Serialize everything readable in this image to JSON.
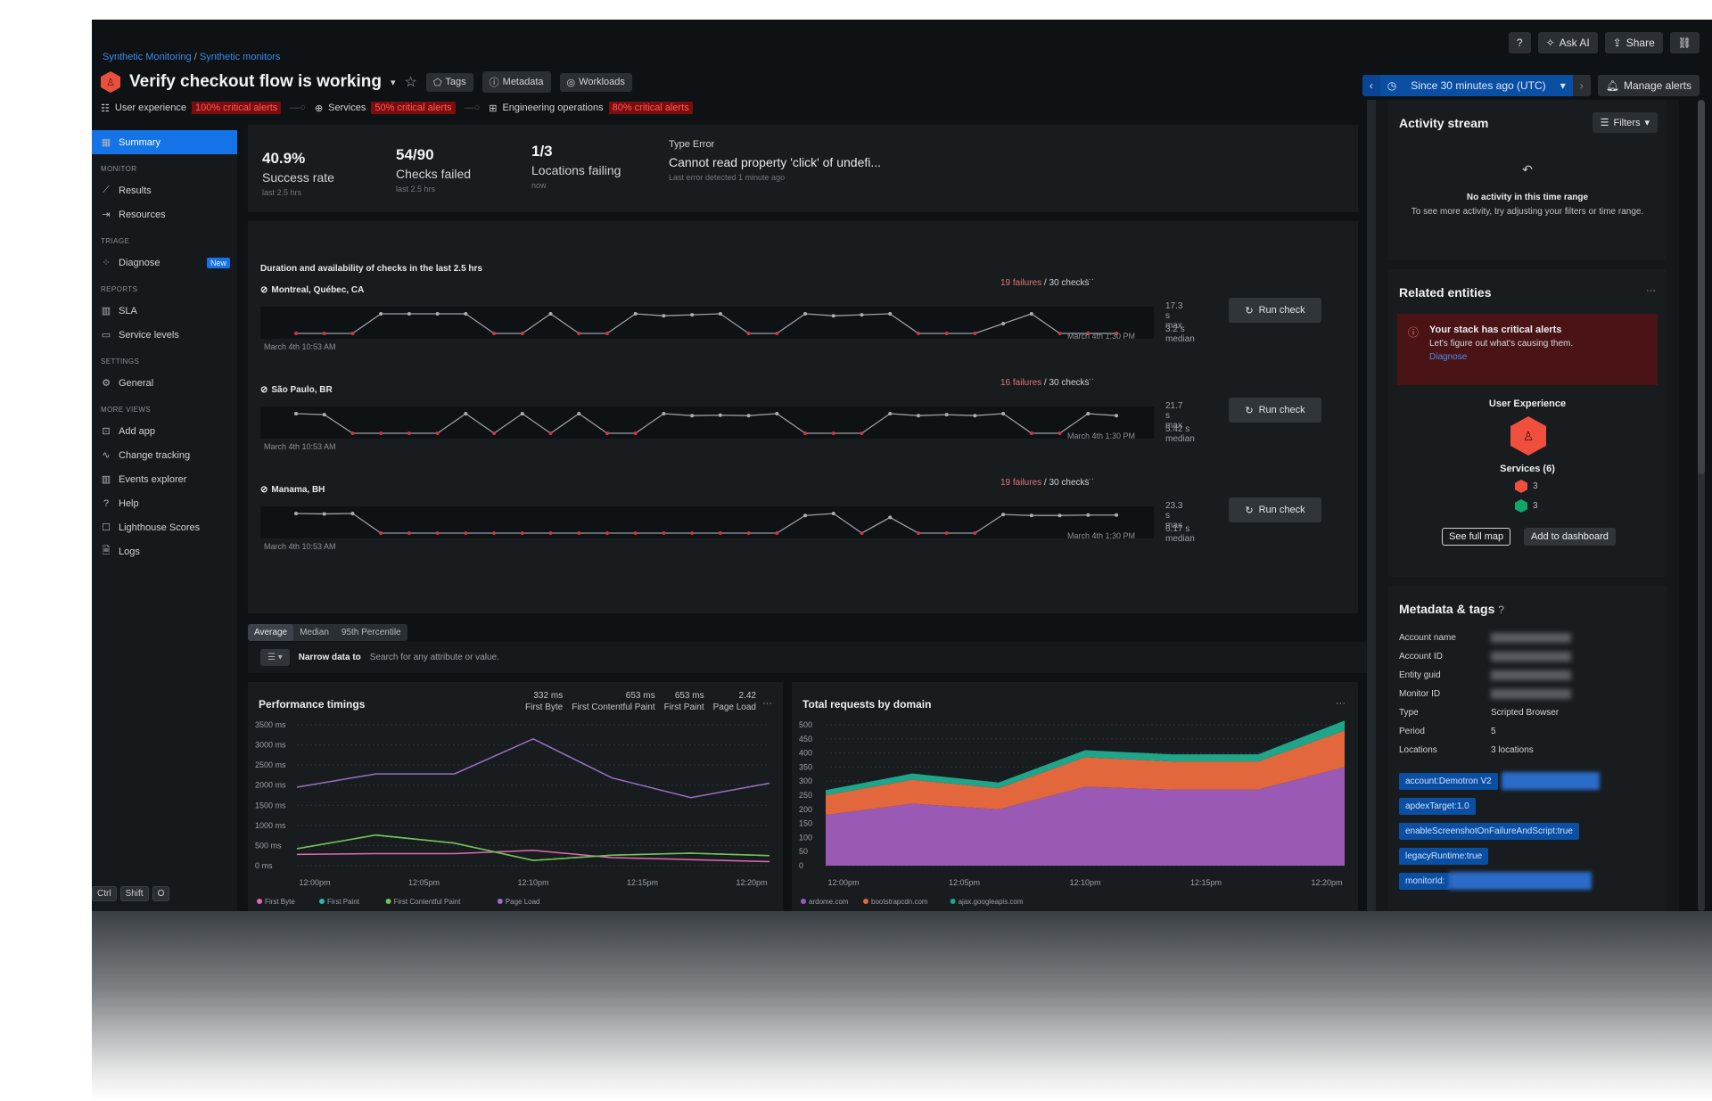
{
  "breadcrumb": {
    "parent": "Synthetic Monitoring",
    "child": "Synthetic monitors"
  },
  "header": {
    "title": "Verify checkout flow is working",
    "buttons": {
      "tags": "Tags",
      "metadata": "Metadata",
      "workloads": "Workloads"
    },
    "alerts": [
      {
        "label": "User experience",
        "badge": "100% critical alerts"
      },
      {
        "label": "Services",
        "badge": "50% critical alerts"
      },
      {
        "label": "Engineering operations",
        "badge": "80% critical alerts"
      }
    ],
    "top_right": {
      "ask_ai": "Ask AI",
      "share": "Share"
    },
    "time_picker": "Since 30 minutes ago (UTC)",
    "manage_alerts": "Manage alerts"
  },
  "sidebar": {
    "summary": "Summary",
    "sections": [
      {
        "title": "MONITOR",
        "items": [
          "Results",
          "Resources"
        ]
      },
      {
        "title": "TRIAGE",
        "items": [
          "Diagnose"
        ]
      },
      {
        "title": "REPORTS",
        "items": [
          "SLA",
          "Service levels"
        ]
      },
      {
        "title": "SETTINGS",
        "items": [
          "General"
        ]
      },
      {
        "title": "MORE VIEWS",
        "items": [
          "Add app",
          "Change tracking",
          "Events explorer",
          "Help",
          "Lighthouse Scores",
          "Logs"
        ]
      }
    ],
    "new_badge": "New"
  },
  "stats": [
    {
      "value": "40.9%",
      "label": "Success rate",
      "sub": "last 2.5 hrs"
    },
    {
      "value": "54/90",
      "label": "Checks failed",
      "sub": "last 2.5 hrs"
    },
    {
      "value": "1/3",
      "label": "Locations failing",
      "sub": "now"
    }
  ],
  "error": {
    "type": "Type Error",
    "message": "Cannot read property 'click' of undefi...",
    "sub": "Last error detected 1 minute ago"
  },
  "duration": {
    "title": "Duration and availability of checks in the last 2.5 hrs",
    "run_label": "Run check",
    "locations": [
      {
        "name": "Montreal, Québec, CA",
        "failures": "19 failures",
        "checks": "/ 30 checks",
        "max": "17.3 s max",
        "median": "3.2 s median",
        "start": "March 4th 10:53 AM",
        "end": "March 4th 1:30 PM",
        "points": [
          0,
          0,
          0,
          1,
          1,
          1,
          1,
          0,
          0,
          1,
          0,
          0,
          1,
          0.9,
          0.95,
          1,
          0,
          0,
          1,
          0.9,
          0.95,
          1,
          0,
          0,
          0,
          0.5,
          1,
          0,
          0,
          0
        ],
        "fail": [
          1,
          1,
          1,
          0,
          0,
          0,
          0,
          1,
          1,
          0,
          1,
          1,
          0,
          0,
          0,
          0,
          1,
          1,
          0,
          0,
          0,
          0,
          1,
          1,
          1,
          0,
          0,
          1,
          1,
          1
        ]
      },
      {
        "name": "São Paulo, BR",
        "failures": "16 failures",
        "checks": "/ 30 checks",
        "max": "21.7 s max",
        "median": "5.42 s median",
        "start": "March 4th 10:53 AM",
        "end": "March 4th 1:30 PM",
        "points": [
          1,
          0.95,
          0,
          0,
          0,
          0,
          1,
          0,
          1,
          0,
          1,
          0,
          0,
          1,
          0.9,
          0.92,
          0.9,
          1,
          0,
          0,
          0,
          1,
          0.9,
          0.95,
          0.9,
          1,
          0,
          0,
          1,
          0.9
        ],
        "fail": [
          0,
          0,
          1,
          1,
          1,
          1,
          0,
          1,
          0,
          1,
          0,
          1,
          1,
          0,
          0,
          0,
          0,
          0,
          1,
          1,
          1,
          0,
          0,
          0,
          0,
          0,
          1,
          1,
          0,
          0
        ]
      },
      {
        "name": "Manama, BH",
        "failures": "19 failures",
        "checks": "/ 30 checks",
        "max": "23.3 s max",
        "median": "6.17 s median",
        "start": "March 4th 10:53 AM",
        "end": "March 4th 1:30 PM",
        "points": [
          1,
          0.98,
          1,
          0,
          0,
          0,
          0,
          0,
          0,
          0,
          0,
          0,
          0,
          0,
          0,
          0,
          0,
          0,
          0.9,
          1,
          0,
          0.8,
          0,
          0,
          0,
          0.95,
          0.9,
          0.9,
          0.92,
          0.92
        ],
        "fail": [
          0,
          0,
          0,
          1,
          1,
          1,
          1,
          1,
          1,
          1,
          1,
          1,
          1,
          1,
          1,
          1,
          1,
          1,
          0,
          0,
          1,
          0,
          1,
          1,
          1,
          0,
          0,
          0,
          0,
          0
        ]
      }
    ]
  },
  "aggregation": {
    "tabs": [
      "Average",
      "Median",
      "95th Percentile"
    ],
    "active": "Average"
  },
  "filter": {
    "label": "Narrow data to",
    "placeholder": "Search for any attribute or value."
  },
  "chart_data": [
    {
      "type": "line",
      "title": "Performance timings",
      "summary": [
        {
          "value": "332 ms",
          "label": "First Byte"
        },
        {
          "value": "653 ms",
          "label": "First Contentful Paint"
        },
        {
          "value": "653 ms",
          "label": "First Paint"
        },
        {
          "value": "2.42",
          "label": "Page Load"
        }
      ],
      "x": [
        "12:00pm",
        "12:03pm",
        "12:07pm",
        "12:11pm",
        "12:15pm",
        "12:19pm",
        "12:23pm"
      ],
      "xticks": [
        "12:00pm",
        "12:05pm",
        "12:10pm",
        "12:15pm",
        "12:20pm"
      ],
      "yticks": [
        "0 ms",
        "500 ms",
        "1000 ms",
        "1500 ms",
        "2000 ms",
        "2500 ms",
        "3000 ms",
        "3500 ms"
      ],
      "ylim": [
        0,
        3500
      ],
      "series": [
        {
          "name": "First Byte",
          "color": "#e06ab0",
          "values": [
            280,
            300,
            300,
            380,
            200,
            150,
            100
          ]
        },
        {
          "name": "First Paint",
          "color": "#2ab7a9",
          "values": [
            420,
            760,
            560,
            130,
            260,
            310,
            250
          ]
        },
        {
          "name": "First Contentful Paint",
          "color": "#7cc04f",
          "values": [
            420,
            760,
            560,
            130,
            260,
            310,
            250
          ]
        },
        {
          "name": "Page Load",
          "color": "#9a6fc5",
          "values": [
            1950,
            2280,
            2280,
            3150,
            2180,
            1690,
            2050
          ]
        }
      ],
      "legend": "bottom"
    },
    {
      "type": "area",
      "title": "Total requests by domain",
      "x": [
        "12:00pm",
        "12:03pm",
        "12:07pm",
        "12:11pm",
        "12:15pm",
        "12:19pm",
        "12:23pm"
      ],
      "xticks": [
        "12:00pm",
        "12:05pm",
        "12:10pm",
        "12:15pm",
        "12:20pm"
      ],
      "yticks": [
        "0",
        "50",
        "100",
        "150",
        "200",
        "250",
        "300",
        "350",
        "400",
        "450",
        "500"
      ],
      "ylim": [
        0,
        500
      ],
      "stacked": true,
      "series": [
        {
          "name": "ardome.com",
          "color": "#9b59b6",
          "values": [
            180,
            220,
            200,
            280,
            270,
            270,
            350
          ]
        },
        {
          "name": "bootstrapcdn.com",
          "color": "#e2673d",
          "values": [
            70,
            85,
            75,
            105,
            100,
            100,
            130
          ]
        },
        {
          "name": "ajax.googleapis.com",
          "color": "#1fa589",
          "values": [
            18,
            22,
            20,
            25,
            25,
            25,
            35
          ]
        }
      ],
      "legend": "bottom"
    }
  ],
  "activity": {
    "title": "Activity stream",
    "filters": "Filters",
    "empty_title": "No activity in this time range",
    "empty_body": "To see more activity, try adjusting your filters or time range."
  },
  "related": {
    "title": "Related entities",
    "alert_title": "Your stack has critical alerts",
    "alert_body": "Let's figure out what's causing them.",
    "alert_link": "Diagnose",
    "entity": "User Experience",
    "services": "Services (6)",
    "critical_count": "3",
    "healthy_count": "3",
    "see_full_map": "See full map",
    "add_to_dashboard": "Add to dashboard"
  },
  "metadata": {
    "title": "Metadata & tags",
    "rows": [
      {
        "key": "Account name",
        "value": ""
      },
      {
        "key": "Account ID",
        "value": ""
      },
      {
        "key": "Entity guid",
        "value": ""
      },
      {
        "key": "Monitor ID",
        "value": ""
      },
      {
        "key": "Type",
        "value": "Scripted Browser"
      },
      {
        "key": "Period",
        "value": "5"
      },
      {
        "key": "Locations",
        "value": "3 locations"
      }
    ],
    "tags": [
      "account:Demotron V2",
      "apdexTarget:1.0",
      "enableScreenshotOnFailureAndScript:true",
      "legacyRuntime:true",
      "monitorId:"
    ]
  },
  "shortcut": [
    "Ctrl",
    "Shift",
    "O"
  ]
}
